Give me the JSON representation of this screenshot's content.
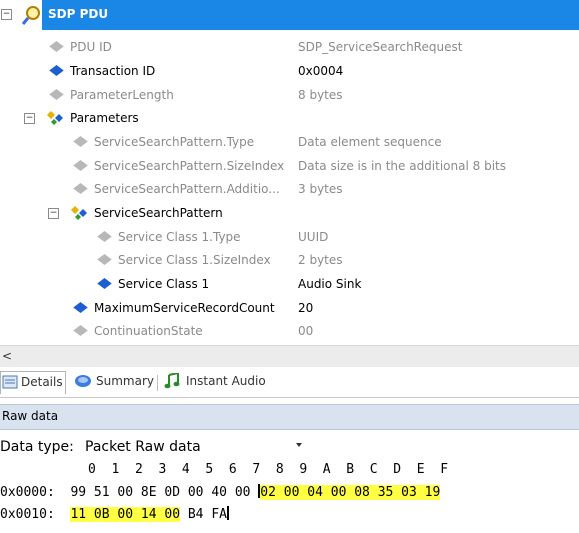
{
  "header": {
    "title": "SDP PDU"
  },
  "rows": [
    {
      "name": "PDU ID",
      "value": "SDP_ServiceSearchRequest"
    },
    {
      "name": "Transaction ID",
      "value": "0x0004"
    },
    {
      "name": "ParameterLength",
      "value": "8 bytes"
    },
    {
      "name": "Parameters",
      "value": ""
    },
    {
      "name": "ServiceSearchPattern.Type",
      "value": "Data element sequence"
    },
    {
      "name": "ServiceSearchPattern.SizeIndex",
      "value": "Data size is in the additional 8 bits"
    },
    {
      "name": "ServiceSearchPattern.Additio...",
      "value": "3 bytes"
    },
    {
      "name": "ServiceSearchPattern",
      "value": ""
    },
    {
      "name": "Service Class 1.Type",
      "value": "UUID"
    },
    {
      "name": "Service Class 1.SizeIndex",
      "value": "2 bytes"
    },
    {
      "name": "Service Class 1",
      "value": "Audio Sink"
    },
    {
      "name": "MaximumServiceRecordCount",
      "value": "20"
    },
    {
      "name": "ContinuationState",
      "value": "00"
    }
  ],
  "tabs": [
    {
      "label": "Details"
    },
    {
      "label": "Summary"
    },
    {
      "label": "Instant Audio"
    }
  ],
  "raw": {
    "title": "Raw data",
    "data_type_label": "Data type:",
    "data_type_value": "Packet Raw data",
    "col_header": "0  1  2  3  4  5  6  7  8  9  A  B  C  D  E  F",
    "rows": [
      {
        "offset": "0x0000:",
        "plain": "99 51 00 8E 0D 00 40 00 ",
        "highlight": "02 00 04 00 08 35 03 19"
      },
      {
        "offset": "0x0010:",
        "highlight": "11 0B 00 14 00",
        "plain": " B4 FA"
      }
    ]
  }
}
